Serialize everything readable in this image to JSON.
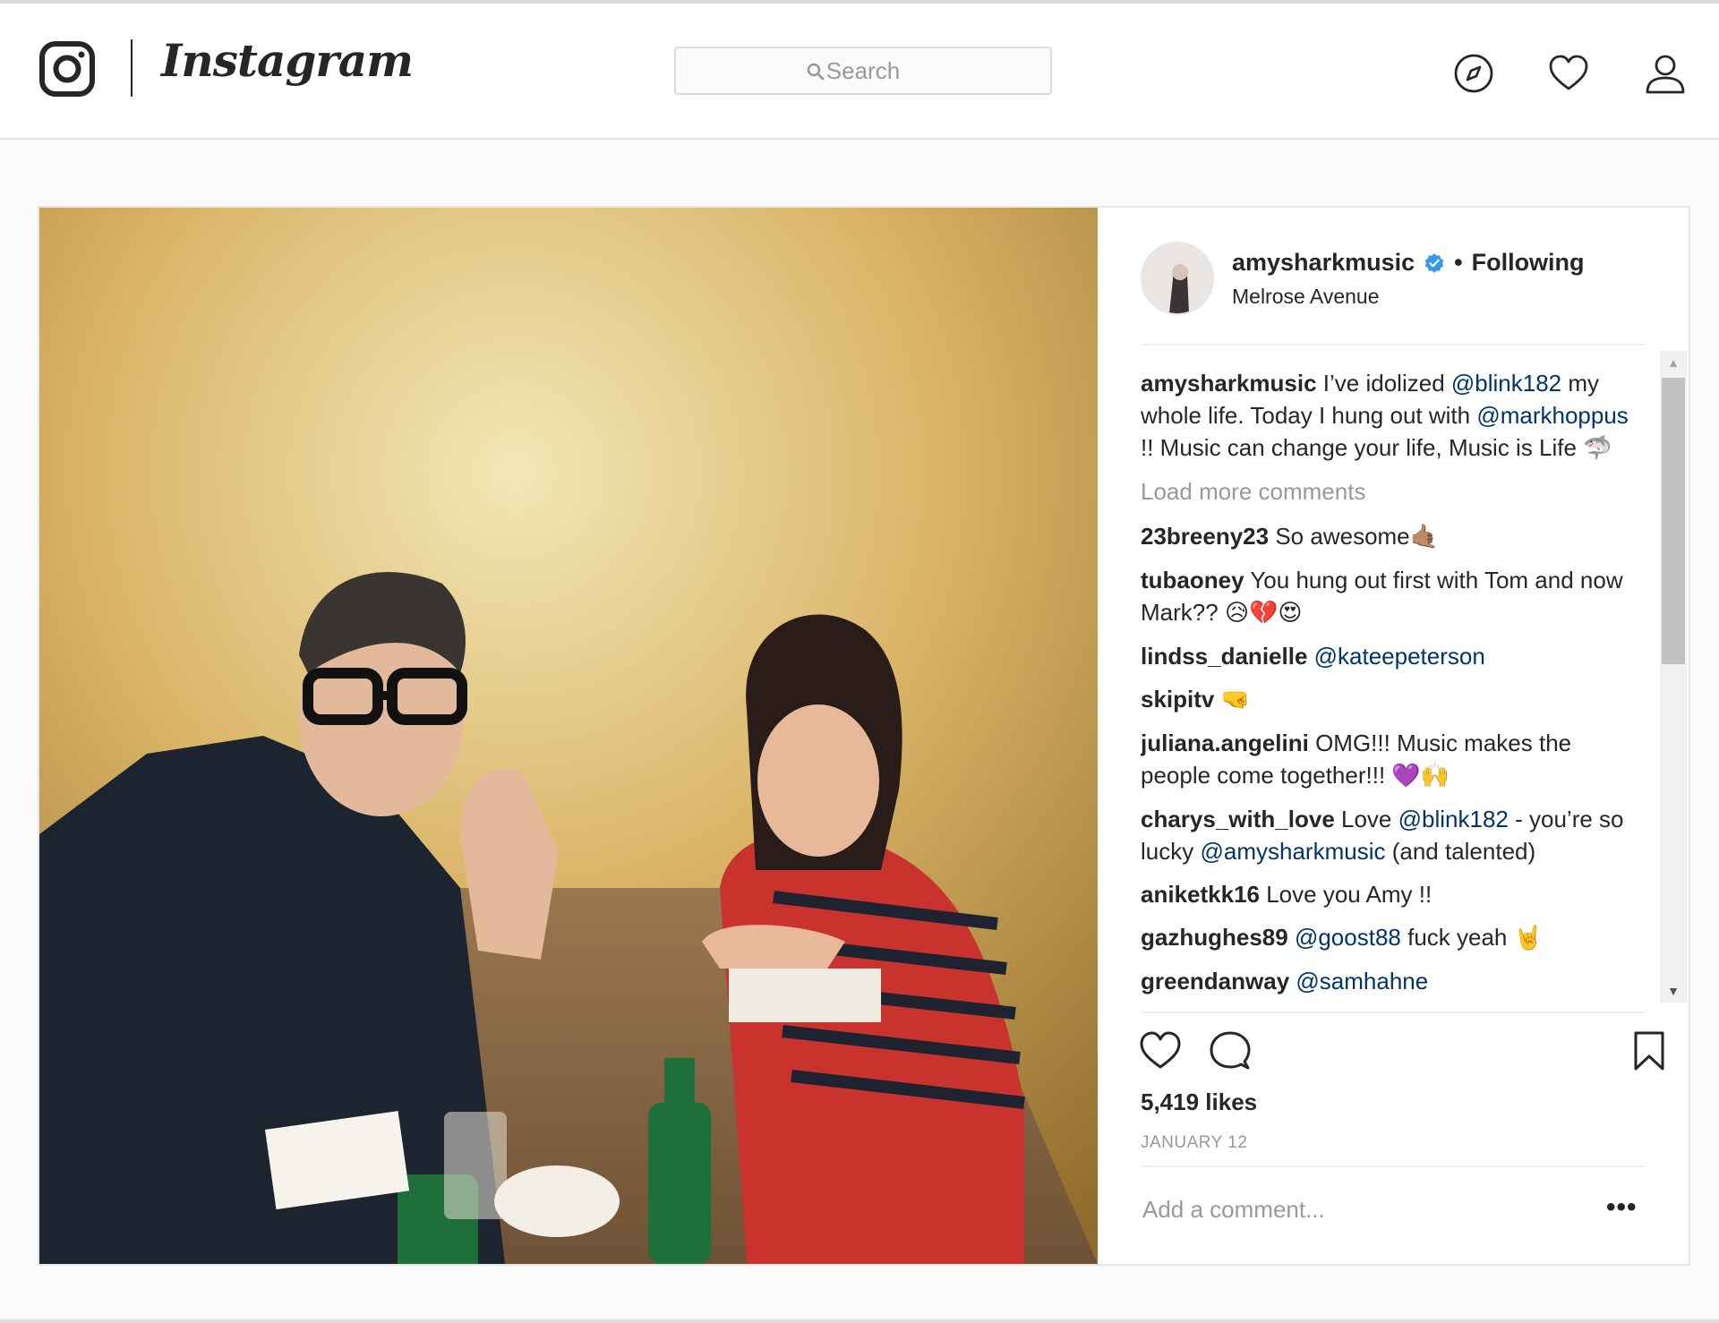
{
  "app": {
    "name": "Instagram",
    "brand_color": "#262626",
    "link_color": "#003569",
    "verified_color": "#3897f0"
  },
  "nav": {
    "search_placeholder": "Search",
    "icons": [
      "explore-compass-icon",
      "activity-heart-icon",
      "profile-person-icon"
    ]
  },
  "post": {
    "username": "amysharkmusic",
    "verified": true,
    "separator": "•",
    "follow_state": "Following",
    "location": "Melrose Avenue",
    "caption": {
      "user": "amysharkmusic",
      "t1": "I’ve idolized",
      "m1": "@blink182",
      "t2": "my whole life. Today I hung out with",
      "m2": "@markhoppus",
      "t3": "!! Music can change your life, Music is Life",
      "emoji": "🦈"
    },
    "load_more": "Load more comments",
    "comments": [
      {
        "user": "23breeny23",
        "text": "So awesome",
        "emoji": "🤙🏽"
      },
      {
        "user": "tubaoney",
        "text": "You hung out first with Tom and now Mark??",
        "emoji": "😥💔😍"
      },
      {
        "user": "lindss_danielle",
        "mention": "@kateepeterson"
      },
      {
        "user": "skipitv",
        "emoji": "🤜"
      },
      {
        "user": "juliana.angelini",
        "text": "OMG!!! Music makes the people come together!!!",
        "emoji": "💜🙌"
      },
      {
        "user": "charys_with_love",
        "t1": "Love",
        "m1": "@blink182",
        "t2": "- you’re so lucky",
        "m2": "@amysharkmusic",
        "t3": "(and talented)"
      },
      {
        "user": "aniketkk16",
        "text": "Love you Amy !!"
      },
      {
        "user": "gazhughes89",
        "mention": "@goost88",
        "text": "fuck yeah",
        "emoji": "🤘"
      },
      {
        "user": "greendanway",
        "mention": "@samhahne"
      }
    ],
    "likes": "5,419 likes",
    "date": "JANUARY 12",
    "add_comment_placeholder": "Add a comment...",
    "more_options": "•••"
  }
}
